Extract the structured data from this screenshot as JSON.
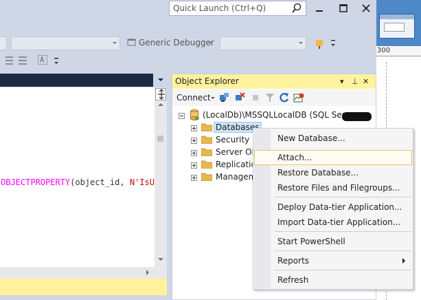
{
  "titlebar": {
    "quick_launch_placeholder": "Quick Launch (Ctrl+Q)"
  },
  "toolbar": {
    "debugger_label": "Generic Debugger"
  },
  "background_app": {
    "ruler_value": "300"
  },
  "editor": {
    "code_fn": "OBJECTPROPERTY",
    "code_args": "(object_id, ",
    "code_str": "N'IsUs"
  },
  "object_explorer": {
    "title": "Object Explorer",
    "header_buttons": [
      "▾",
      "⊥",
      "✕"
    ],
    "connect_label": "Connect",
    "server_node": "(LocalDb)\\MSSQLLocalDB (SQL Server",
    "nodes": [
      "Databases",
      "Security",
      "Server Obj",
      "Replication",
      "Managem"
    ]
  },
  "context_menu": {
    "items": [
      "New Database...",
      "Attach...",
      "Restore Database...",
      "Restore Files and Filegroups...",
      "Deploy Data-tier Application...",
      "Import Data-tier Application...",
      "Start PowerShell",
      "Reports",
      "Refresh"
    ]
  },
  "colors": {
    "accent_yellow": "#FFF29D",
    "selection_blue": "#CCE4F7",
    "chrome": "#CFD6E5"
  }
}
